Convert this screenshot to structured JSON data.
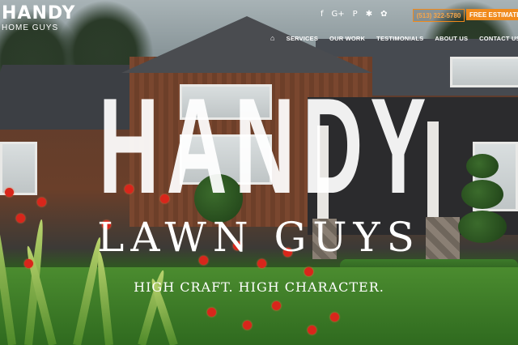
{
  "logo": {
    "main": "HANDY",
    "sub": "HOME GUYS"
  },
  "social": {
    "icons": [
      "facebook-icon",
      "google-plus-icon",
      "pinterest-icon",
      "yelp-icon",
      "houzz-icon"
    ],
    "glyphs": [
      "f",
      "G+",
      "P",
      "✱",
      "✿"
    ]
  },
  "header": {
    "phone": "(513) 322-5780",
    "estimate": "FREE ESTIMATE"
  },
  "nav": {
    "home_glyph": "⌂",
    "items": [
      "SERVICES",
      "OUR WORK",
      "TESTIMONIALS",
      "ABOUT US",
      "CONTACT US"
    ]
  },
  "hero": {
    "headline": "HANDY",
    "subline": "LAWN GUYS",
    "tagline": "HIGH CRAFT. HIGH CHARACTER."
  },
  "colors": {
    "accent": "#f08a1c",
    "text": "#ffffff"
  }
}
